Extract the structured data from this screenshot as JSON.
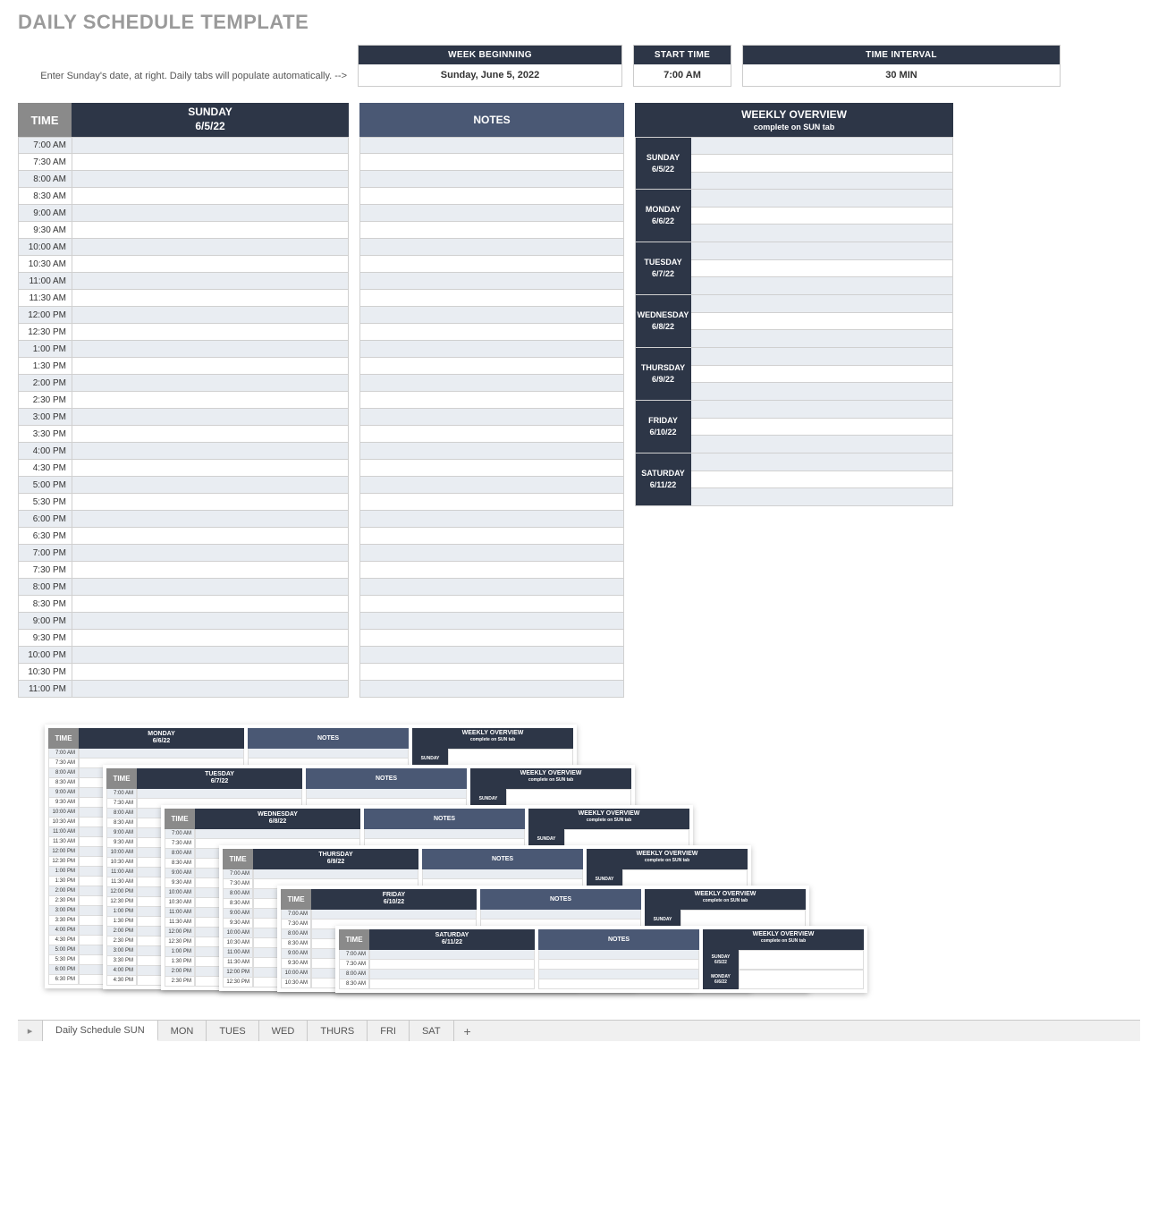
{
  "title": "DAILY SCHEDULE TEMPLATE",
  "instruction": "Enter Sunday's date, at right.  Daily tabs will populate automatically.  -->",
  "settings": {
    "week_beginning_label": "WEEK BEGINNING",
    "week_beginning_value": "Sunday, June 5, 2022",
    "start_time_label": "START TIME",
    "start_time_value": "7:00 AM",
    "time_interval_label": "TIME INTERVAL",
    "time_interval_value": "30 MIN"
  },
  "time_header": "TIME",
  "notes_header": "NOTES",
  "overview_header": "WEEKLY OVERVIEW",
  "overview_sub": "complete on SUN tab",
  "day": {
    "name": "SUNDAY",
    "date": "6/5/22"
  },
  "times": [
    "7:00 AM",
    "7:30 AM",
    "8:00 AM",
    "8:30 AM",
    "9:00 AM",
    "9:30 AM",
    "10:00 AM",
    "10:30 AM",
    "11:00 AM",
    "11:30 AM",
    "12:00 PM",
    "12:30 PM",
    "1:00 PM",
    "1:30 PM",
    "2:00 PM",
    "2:30 PM",
    "3:00 PM",
    "3:30 PM",
    "4:00 PM",
    "4:30 PM",
    "5:00 PM",
    "5:30 PM",
    "6:00 PM",
    "6:30 PM",
    "7:00 PM",
    "7:30 PM",
    "8:00 PM",
    "8:30 PM",
    "9:00 PM",
    "9:30 PM",
    "10:00 PM",
    "10:30 PM",
    "11:00 PM"
  ],
  "overview_days": [
    {
      "name": "SUNDAY",
      "date": "6/5/22"
    },
    {
      "name": "MONDAY",
      "date": "6/6/22"
    },
    {
      "name": "TUESDAY",
      "date": "6/7/22"
    },
    {
      "name": "WEDNESDAY",
      "date": "6/8/22"
    },
    {
      "name": "THURSDAY",
      "date": "6/9/22"
    },
    {
      "name": "FRIDAY",
      "date": "6/10/22"
    },
    {
      "name": "SATURDAY",
      "date": "6/11/22"
    }
  ],
  "previews": [
    {
      "name": "MONDAY",
      "date": "6/6/22"
    },
    {
      "name": "TUESDAY",
      "date": "6/7/22"
    },
    {
      "name": "WEDNESDAY",
      "date": "6/8/22"
    },
    {
      "name": "THURSDAY",
      "date": "6/9/22"
    },
    {
      "name": "FRIDAY",
      "date": "6/10/22"
    },
    {
      "name": "SATURDAY",
      "date": "6/11/22"
    }
  ],
  "preview_sunday_label": "SUNDAY",
  "tabs": [
    "Daily Schedule SUN",
    "MON",
    "TUES",
    "WED",
    "THURS",
    "FRI",
    "SAT"
  ]
}
